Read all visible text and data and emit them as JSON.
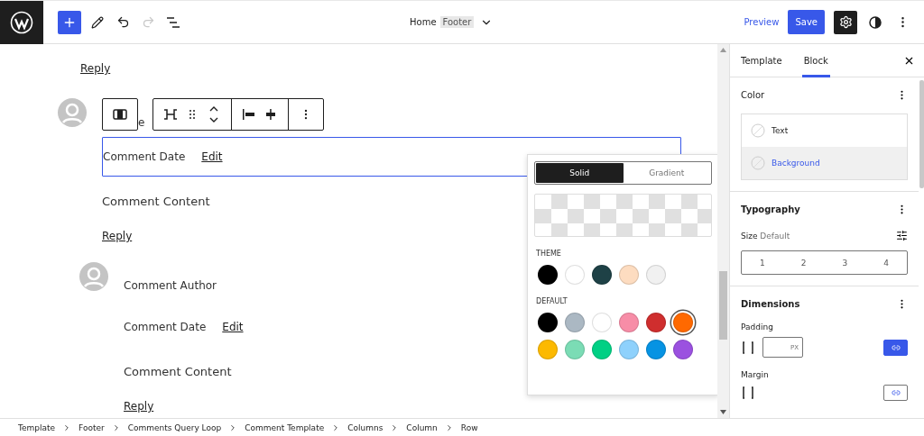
{
  "topbar": {
    "redo_disabled": true,
    "document": {
      "title": "Home",
      "template": "Footer"
    },
    "preview": "Preview",
    "save": "Save",
    "settings_selected": true
  },
  "canvas": {
    "top_reply": "Reply",
    "comments": [
      {
        "author": "e",
        "date": "Comment Date",
        "edit": "Edit",
        "content": "Comment Content",
        "reply": "Reply",
        "selected": true
      },
      {
        "author": "Comment Author",
        "date": "Comment Date",
        "edit": "Edit",
        "content": "Comment Content",
        "reply": "Reply",
        "selected": false
      }
    ]
  },
  "color_popover": {
    "tabs": [
      {
        "label": "Solid",
        "selected": true
      },
      {
        "label": "Gradient",
        "selected": false
      }
    ],
    "palettes": [
      {
        "label": "THEME",
        "swatches": [
          {
            "color": "#000000",
            "selected": false
          },
          {
            "color": "#ffffff",
            "selected": false
          },
          {
            "color": "#1e4146",
            "selected": false
          },
          {
            "color": "#fddcc0",
            "selected": false
          },
          {
            "color": "#f1f1f1",
            "selected": false
          }
        ]
      },
      {
        "label": "DEFAULT",
        "swatches": [
          {
            "color": "#000000",
            "selected": false
          },
          {
            "color": "#abb8c3",
            "selected": false
          },
          {
            "color": "#ffffff",
            "selected": false
          },
          {
            "color": "#f78da7",
            "selected": false
          },
          {
            "color": "#cf2e2e",
            "selected": false
          },
          {
            "color": "#ff6900",
            "selected": true
          },
          {
            "color": "#fcb900",
            "selected": false
          },
          {
            "color": "#7bdcb5",
            "selected": false
          },
          {
            "color": "#00d084",
            "selected": false
          },
          {
            "color": "#8ed1fc",
            "selected": false
          },
          {
            "color": "#0693e3",
            "selected": false
          },
          {
            "color": "#9b51e0",
            "selected": false
          }
        ]
      }
    ]
  },
  "sidebar": {
    "tabs": [
      {
        "label": "Template",
        "selected": false
      },
      {
        "label": "Block",
        "selected": true
      }
    ],
    "sections": [
      {
        "kind": "color",
        "title": "Color",
        "items": [
          {
            "label": "Text",
            "selected": false
          },
          {
            "label": "Background",
            "selected": true
          }
        ]
      },
      {
        "kind": "typography",
        "title": "Typography",
        "size_label": "Size",
        "size_value": "Default",
        "options": [
          "1",
          "2",
          "3",
          "4"
        ]
      },
      {
        "kind": "dimensions",
        "title": "Dimensions",
        "controls": [
          {
            "label": "Padding",
            "unit": "PX",
            "linked": true
          },
          {
            "label": "Margin",
            "linked": false
          }
        ]
      }
    ]
  },
  "breadcrumb": [
    "Template",
    "Footer",
    "Comments Query Loop",
    "Comment Template",
    "Columns",
    "Column",
    "Row"
  ]
}
